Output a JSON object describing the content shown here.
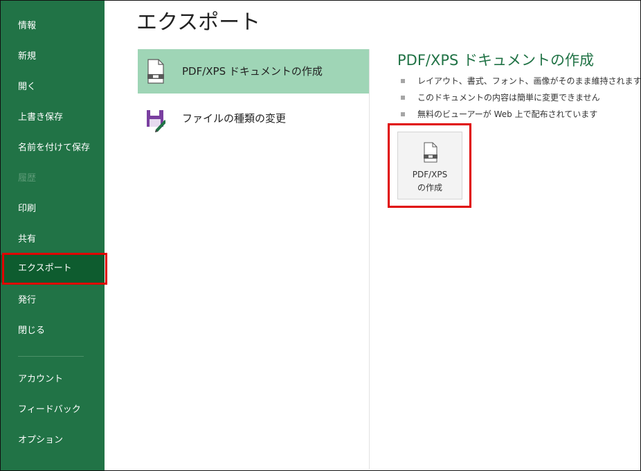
{
  "sidebar": {
    "items": [
      {
        "label": "情報"
      },
      {
        "label": "新規"
      },
      {
        "label": "開く"
      },
      {
        "label": "上書き保存"
      },
      {
        "label": "名前を付けて保存"
      },
      {
        "label": "履歴"
      },
      {
        "label": "印刷"
      },
      {
        "label": "共有"
      },
      {
        "label": "エクスポート"
      },
      {
        "label": "発行"
      },
      {
        "label": "閉じる"
      },
      {
        "label": "アカウント"
      },
      {
        "label": "フィードバック"
      },
      {
        "label": "オプション"
      }
    ],
    "selected_label": "エクスポート",
    "disabled_label": "履歴"
  },
  "main": {
    "title": "エクスポート",
    "options": [
      {
        "label": "PDF/XPS ドキュメントの作成",
        "icon": "pdf-document-icon"
      },
      {
        "label": "ファイルの種類の変更",
        "icon": "save-as-edit-icon"
      }
    ],
    "selected_option": "PDF/XPS ドキュメントの作成",
    "detail": {
      "title": "PDF/XPS ドキュメントの作成",
      "bullets": [
        "レイアウト、書式、フォント、画像がそのまま維持されます",
        "このドキュメントの内容は簡単に変更できません",
        "無料のビューアーが Web 上で配布されています"
      ],
      "button": {
        "line1": "PDF/XPS",
        "line2": "の作成",
        "icon": "pdf-document-icon"
      }
    }
  },
  "colors": {
    "sidebar_bg": "#217346",
    "sidebar_selected_bg": "#0e5c2f",
    "option_selected_bg": "#9fd5b6",
    "accent_text": "#217346",
    "highlight_border": "#e00000"
  }
}
